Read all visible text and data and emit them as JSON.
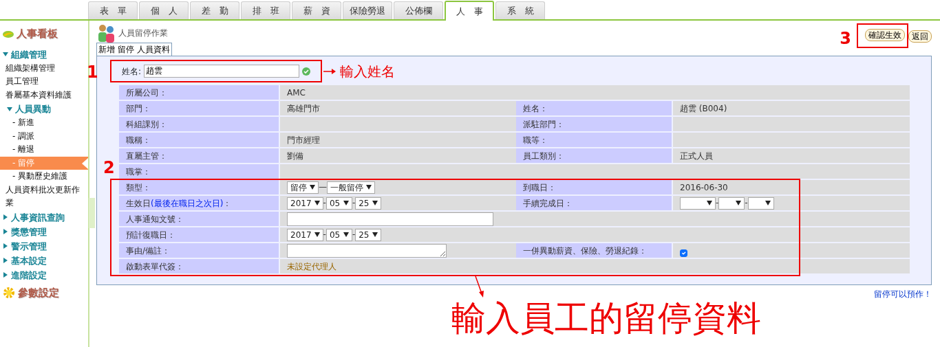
{
  "tabs": [
    {
      "label": "表　單",
      "selected": false
    },
    {
      "label": "個　人",
      "selected": false
    },
    {
      "label": "差　勤",
      "selected": false
    },
    {
      "label": "排　班",
      "selected": false
    },
    {
      "label": "薪　資",
      "selected": false
    },
    {
      "label": "保險勞退",
      "selected": false
    },
    {
      "label": "公佈欄",
      "selected": false
    },
    {
      "label": "人　事",
      "selected": true
    },
    {
      "label": "系　統",
      "selected": false
    }
  ],
  "sidebar": {
    "title": "人事看板",
    "groups": [
      {
        "label": "組織管理",
        "expanded": true,
        "children": [
          {
            "kind": "link",
            "label": "組織架構管理"
          },
          {
            "kind": "link",
            "label": "員工管理"
          },
          {
            "kind": "link",
            "label": "眷屬基本資料維護"
          },
          {
            "kind": "group",
            "label": "人員異動",
            "expanded": true,
            "children": [
              {
                "label": "- 新進",
                "selected": false
              },
              {
                "label": "- 調派",
                "selected": false
              },
              {
                "label": "- 離退",
                "selected": false
              },
              {
                "label": "- 留停",
                "selected": true
              },
              {
                "label": "- 異動歷史維護",
                "selected": false
              }
            ]
          },
          {
            "kind": "link",
            "label": "人員資料批次更新作業"
          }
        ]
      },
      {
        "label": "人事資訊查詢",
        "expanded": false
      },
      {
        "label": "獎懲管理",
        "expanded": false
      },
      {
        "label": "警示管理",
        "expanded": false
      },
      {
        "label": "基本設定",
        "expanded": false
      },
      {
        "label": "進階設定",
        "expanded": false
      }
    ],
    "footer": "參數設定"
  },
  "page_title": "人員留停作業",
  "form_tab": "新增 留停 人員資料",
  "buttons": [
    {
      "label": "確認生效"
    },
    {
      "label": "返回"
    }
  ],
  "name_field": {
    "label": "姓名:",
    "value": "趙雲"
  },
  "form": {
    "rows": [
      {
        "fields": [
          {
            "label": "所屬公司：",
            "kind": "text",
            "value": "AMC"
          }
        ]
      },
      {
        "fields": [
          {
            "label": "部門：",
            "kind": "text",
            "value": "高雄門市"
          },
          {
            "label": "姓名：",
            "kind": "text",
            "value": "趙雲 (B004)"
          }
        ]
      },
      {
        "fields": [
          {
            "label": "科組課別：",
            "kind": "text"
          },
          {
            "label": "派駐部門：",
            "kind": "text"
          }
        ]
      },
      {
        "fields": [
          {
            "label": "職稱：",
            "kind": "text",
            "value": "門市經理"
          },
          {
            "label": "職等：",
            "kind": "text"
          }
        ]
      },
      {
        "fields": [
          {
            "label": "直屬主管：",
            "kind": "text",
            "value": "劉備"
          },
          {
            "label": "員工類別：",
            "kind": "text",
            "value": "正式人員"
          }
        ]
      },
      {
        "fields": [
          {
            "label": "職掌：",
            "kind": "text"
          }
        ]
      }
    ],
    "highlighted_rows": [
      {
        "fields": [
          {
            "label": "類型：",
            "kind": "selects",
            "separator": "—",
            "selects": [
              {
                "value": "留停"
              },
              {
                "value": "一般留停"
              }
            ]
          },
          {
            "label": "到職日：",
            "kind": "text",
            "value": "2016-06-30"
          }
        ]
      },
      {
        "fields": [
          {
            "label": "生效日",
            "label_hint": "(最後在職日之次日)",
            "label_end": "：",
            "kind": "selects",
            "separator": "-",
            "selects": [
              {
                "value": "2017"
              },
              {
                "value": "05"
              },
              {
                "value": "25"
              }
            ]
          },
          {
            "label": "手續完成日：",
            "kind": "blank_date",
            "separator": "-"
          }
        ]
      },
      {
        "fields": [
          {
            "label": "人事通知文號：",
            "kind": "input"
          }
        ]
      },
      {
        "fields": [
          {
            "label": "預計復職日：",
            "kind": "selects",
            "separator": "-",
            "selects": [
              {
                "value": "2017"
              },
              {
                "value": "05"
              },
              {
                "value": "25"
              }
            ]
          }
        ]
      },
      {
        "fields": [
          {
            "label": "事由/備註：",
            "kind": "textarea"
          },
          {
            "label": "一併異動薪資、保險、勞退紀錄：",
            "kind": "checkbox",
            "checked": true
          }
        ]
      },
      {
        "fields": [
          {
            "label": "啟動表單代簽：",
            "kind": "note",
            "value": "未設定代理人"
          }
        ]
      }
    ]
  },
  "note": "留停可以預作！",
  "annotations": {
    "name_step": "1",
    "name_hint": "輸入姓名",
    "form_step": "2",
    "confirm_step": "3",
    "form_hint": "輸入員工的留停資料"
  }
}
